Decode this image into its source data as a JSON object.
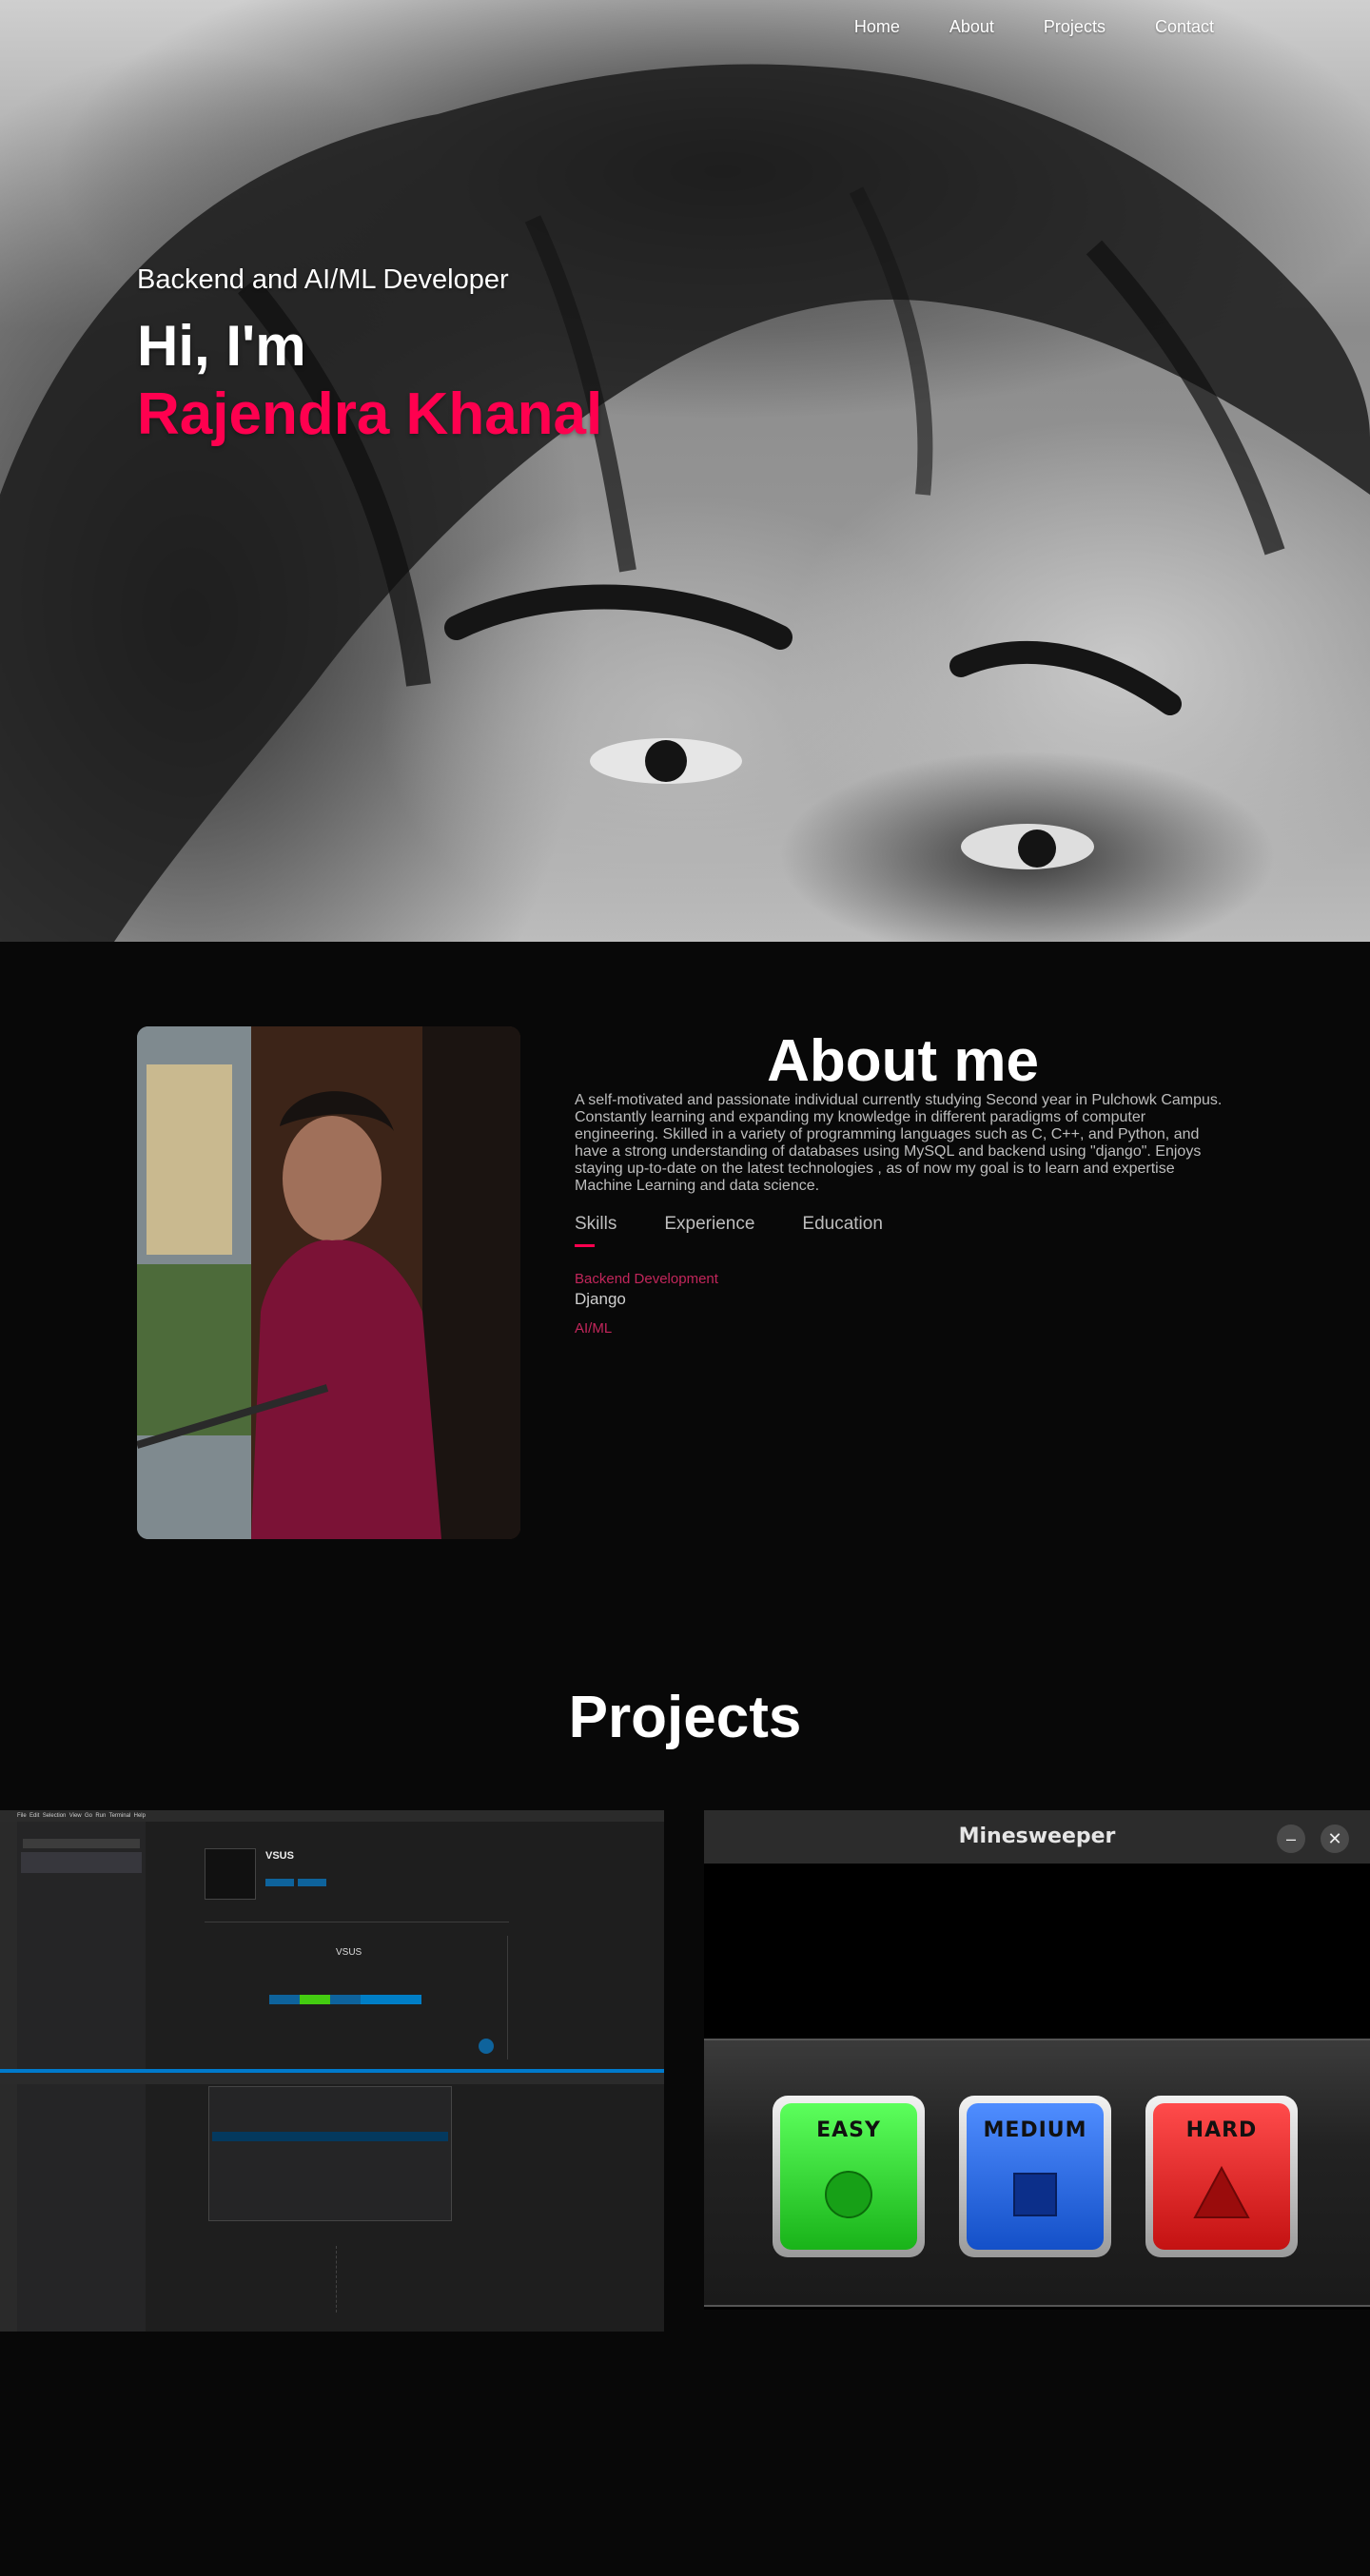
{
  "nav": {
    "items": [
      "Home",
      "About",
      "Projects",
      "Contact"
    ]
  },
  "hero": {
    "subtitle": "Backend and AI/ML Developer",
    "greeting": "Hi, I'm",
    "name": "Rajendra Khanal"
  },
  "about": {
    "title": "About me",
    "description": "A self-motivated and passionate individual currently studying Second year in Pulchowk Campus. Constantly learning and expanding my knowledge in different paradigms of computer engineering. Skilled in a variety of programming languages such as C, C++, and Python, and have a strong understanding of databases using MySQL and backend using \"django\". Enjoys staying up-to-date on the latest technologies , as of now my goal is to learn and expertise Machine Learning and data science.",
    "tabs": [
      "Skills",
      "Experience",
      "Education"
    ],
    "active_tab": "Skills",
    "skills": [
      {
        "heading": "Backend Development",
        "value": "Django"
      },
      {
        "heading": "AI/ML",
        "value": ""
      }
    ]
  },
  "projects": {
    "title": "Projects",
    "vscode": {
      "menu": [
        "File",
        "Edit",
        "Selection",
        "View",
        "Go",
        "Run",
        "Terminal",
        "Help"
      ],
      "extension_name": "VSUS",
      "extension_heading": "VSUS"
    },
    "minesweeper": {
      "title": "Minesweeper",
      "minimize": "–",
      "close": "✕",
      "levels": [
        "EASY",
        "MEDIUM",
        "HARD"
      ]
    }
  },
  "colors": {
    "accent": "#ff004f",
    "background": "#080808",
    "easy": "#1fdc1f",
    "medium": "#1a63e6",
    "hard": "#e61a1a"
  }
}
